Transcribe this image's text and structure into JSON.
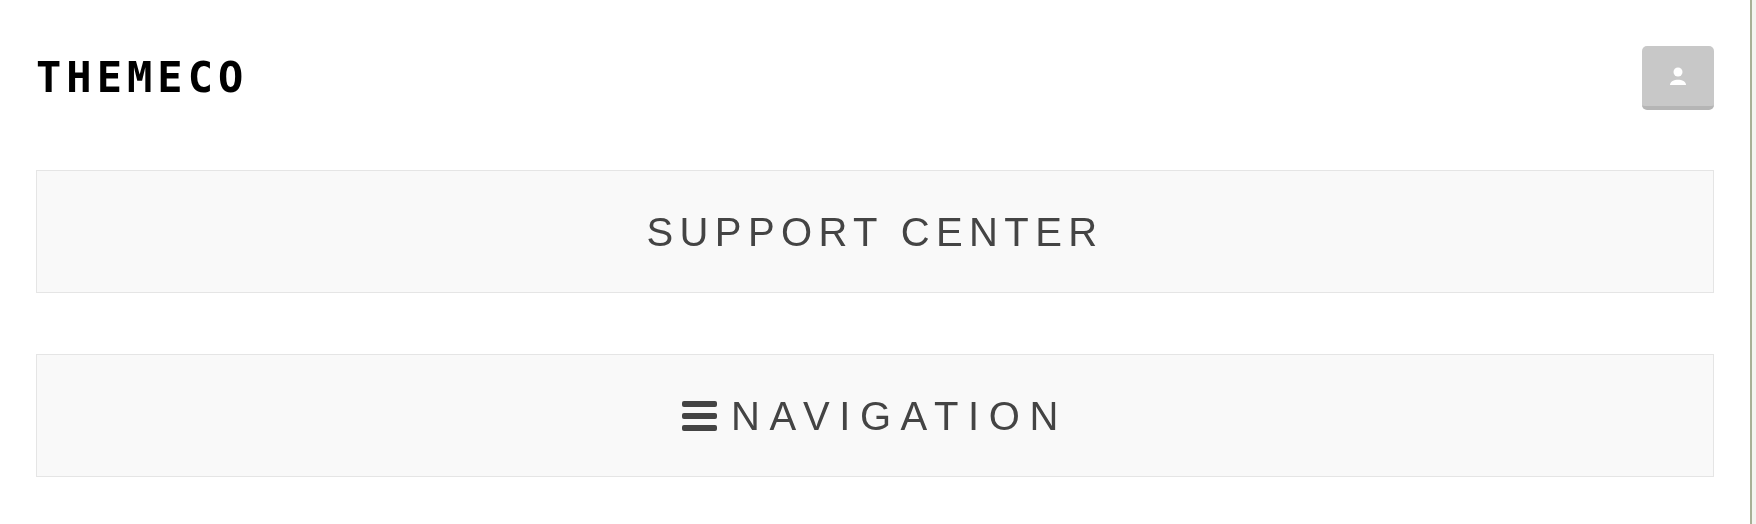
{
  "header": {
    "logo": "THEMECO"
  },
  "panels": [
    {
      "kind": "title",
      "label": "SUPPORT CENTER"
    },
    {
      "kind": "menu",
      "label": "NAVIGATION"
    }
  ]
}
